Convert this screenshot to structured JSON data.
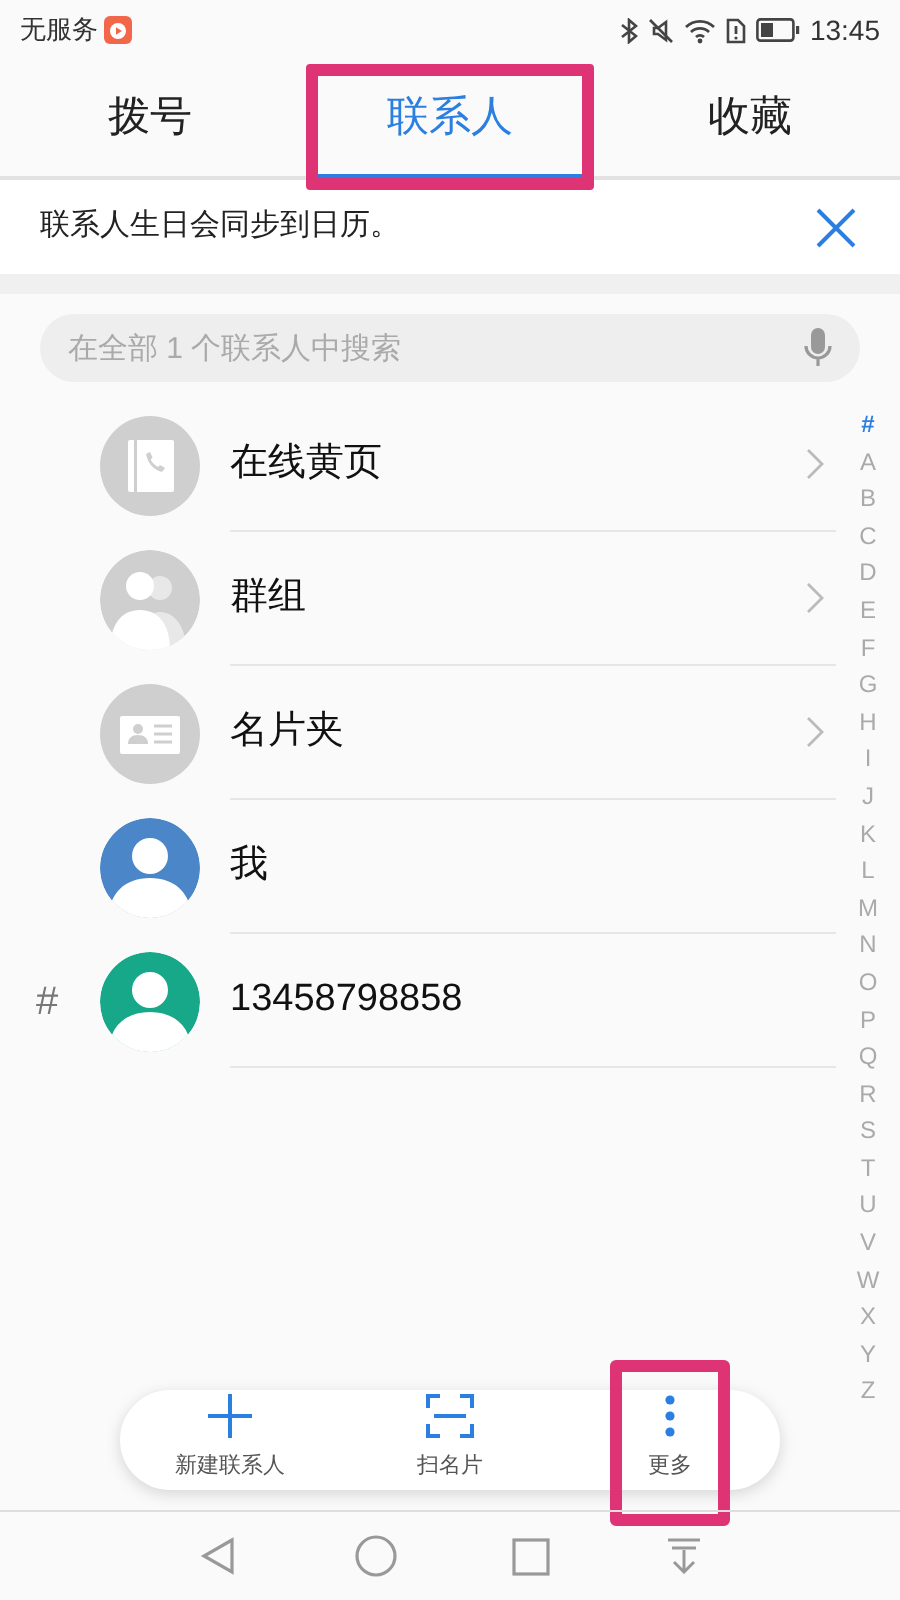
{
  "status_bar": {
    "carrier": "无服务",
    "time": "13:45"
  },
  "tabs": [
    {
      "label": "拨号",
      "selected": false,
      "highlighted": false
    },
    {
      "label": "联系人",
      "selected": true,
      "highlighted": true
    },
    {
      "label": "收藏",
      "selected": false,
      "highlighted": false
    }
  ],
  "banner": {
    "text": "联系人生日会同步到日历。"
  },
  "search": {
    "placeholder": "在全部 1 个联系人中搜索"
  },
  "entries": [
    {
      "kind": "book",
      "name": "在线黄页",
      "chevron": true
    },
    {
      "kind": "groups",
      "name": "群组",
      "chevron": true
    },
    {
      "kind": "card",
      "name": "名片夹",
      "chevron": true
    },
    {
      "kind": "person",
      "name": "我",
      "color": "#4a86c8"
    },
    {
      "kind": "person",
      "name": "13458798858",
      "color": "#17a889",
      "section": "#"
    }
  ],
  "index": [
    {
      "label": "#",
      "selected": true
    },
    {
      "label": "A",
      "selected": false
    },
    {
      "label": "B",
      "selected": false
    },
    {
      "label": "C",
      "selected": false
    },
    {
      "label": "D",
      "selected": false
    },
    {
      "label": "E",
      "selected": false
    },
    {
      "label": "F",
      "selected": false
    },
    {
      "label": "G",
      "selected": false
    },
    {
      "label": "H",
      "selected": false
    },
    {
      "label": "I",
      "selected": false
    },
    {
      "label": "J",
      "selected": false
    },
    {
      "label": "K",
      "selected": false
    },
    {
      "label": "L",
      "selected": false
    },
    {
      "label": "M",
      "selected": false
    },
    {
      "label": "N",
      "selected": false
    },
    {
      "label": "O",
      "selected": false
    },
    {
      "label": "P",
      "selected": false
    },
    {
      "label": "Q",
      "selected": false
    },
    {
      "label": "R",
      "selected": false
    },
    {
      "label": "S",
      "selected": false
    },
    {
      "label": "T",
      "selected": false
    },
    {
      "label": "U",
      "selected": false
    },
    {
      "label": "V",
      "selected": false
    },
    {
      "label": "W",
      "selected": false
    },
    {
      "label": "X",
      "selected": false
    },
    {
      "label": "Y",
      "selected": false
    },
    {
      "label": "Z",
      "selected": false
    }
  ],
  "actions": [
    {
      "kind": "add",
      "label": "新建联系人",
      "highlighted": false
    },
    {
      "kind": "scan",
      "label": "扫名片",
      "highlighted": false
    },
    {
      "kind": "more",
      "label": "更多",
      "highlighted": true
    }
  ]
}
